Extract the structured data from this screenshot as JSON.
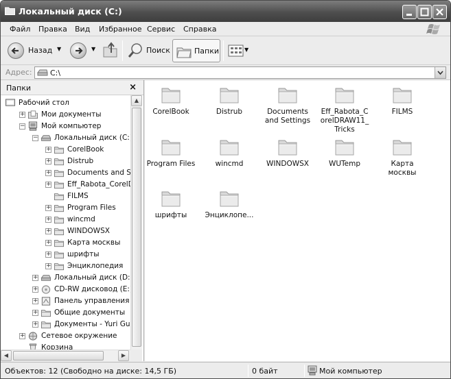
{
  "window": {
    "title": "Локальный диск (C:)"
  },
  "menu": [
    "Файл",
    "Правка",
    "Вид",
    "Избранное",
    "Сервис",
    "Справка"
  ],
  "toolbar": {
    "back": "Назад",
    "search": "Поиск",
    "folders": "Папки"
  },
  "address": {
    "label": "Адрес:",
    "value": "C:\\"
  },
  "folders_pane": {
    "title": "Папки",
    "close": "×",
    "tree": [
      {
        "label": "Рабочий стол",
        "icon": "desktop-icon"
      },
      {
        "label": "Мои документы",
        "icon": "my-documents-icon"
      },
      {
        "label": "Мой компьютер",
        "icon": "my-computer-icon"
      },
      {
        "label": "Локальный диск (C:)",
        "icon": "drive-icon"
      },
      {
        "label": "CorelBook",
        "icon": "folder-icon"
      },
      {
        "label": "Distrub",
        "icon": "folder-icon"
      },
      {
        "label": "Documents and Settin",
        "icon": "folder-icon"
      },
      {
        "label": "Eff_Rabota_CorelDRA",
        "icon": "folder-icon"
      },
      {
        "label": "FILMS",
        "icon": "folder-icon"
      },
      {
        "label": "Program Files",
        "icon": "folder-icon"
      },
      {
        "label": "wincmd",
        "icon": "folder-icon"
      },
      {
        "label": "WINDOWSX",
        "icon": "folder-icon"
      },
      {
        "label": "Карта москвы",
        "icon": "folder-icon"
      },
      {
        "label": "шрифты",
        "icon": "folder-icon"
      },
      {
        "label": "Энциклопедия",
        "icon": "folder-icon"
      },
      {
        "label": "Локальный диск (D:)",
        "icon": "drive-icon"
      },
      {
        "label": "CD-RW дисковод (E:)",
        "icon": "cd-drive-icon"
      },
      {
        "label": "Панель управления",
        "icon": "control-panel-icon"
      },
      {
        "label": "Общие документы",
        "icon": "folder-icon"
      },
      {
        "label": "Документы - Yuri Gurski",
        "icon": "folder-icon"
      },
      {
        "label": "Сетевое окружение",
        "icon": "network-icon"
      },
      {
        "label": "Корзина",
        "icon": "recycle-bin-icon"
      }
    ]
  },
  "content": {
    "items": [
      {
        "label": "CorelBook"
      },
      {
        "label": "Distrub"
      },
      {
        "label": "Documents and Settings"
      },
      {
        "label": "Eff_Rabota_CorelDRAW11_Tricks",
        "lines": [
          "Eff_Rabota_C",
          "orelDRAW11_",
          "Tricks"
        ]
      },
      {
        "label": "FILMS"
      },
      {
        "label": "Program Files"
      },
      {
        "label": "wincmd"
      },
      {
        "label": "WINDOWSX"
      },
      {
        "label": "WUTemp"
      },
      {
        "label": "Карта москвы"
      },
      {
        "label": "шрифты"
      },
      {
        "label": "Энциклопе..."
      }
    ]
  },
  "status": {
    "objects": "Объектов: 12 (Свободно на диске: 14,5 ГБ)",
    "size": "0 байт",
    "location": "Мой компьютер"
  }
}
